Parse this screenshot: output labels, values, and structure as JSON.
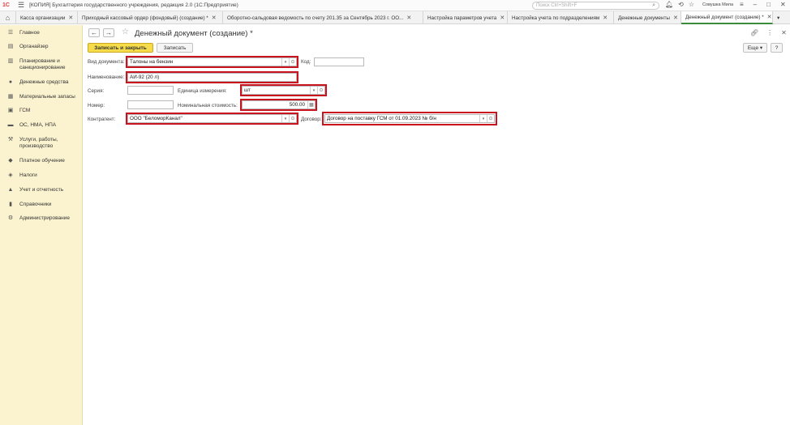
{
  "app": {
    "logo": "1С",
    "title": "[КОПИЯ] Бухгалтерия государственного учреждения, редакция 2.0  (1С:Предприятие)",
    "search_placeholder": "Поиск Ctrl+Shift+F",
    "user": "Совушка Мила"
  },
  "tabs": [
    {
      "label": "Касса организации"
    },
    {
      "label": "Приходный кассовый ордер (фондовый) (создание) *"
    },
    {
      "label": "Оборотно-сальдовая ведомость по счету 201.35 за Сентябрь 2023 г. ОО..."
    },
    {
      "label": "Настройка параметров учета"
    },
    {
      "label": "Настройка учета по подразделениям"
    },
    {
      "label": "Денежные документы"
    },
    {
      "label": "Денежный документ (создание) *"
    }
  ],
  "sidebar": {
    "items": [
      {
        "label": "Главное",
        "icon": "menu-icon"
      },
      {
        "label": "Органайзер",
        "icon": "organizer-icon"
      },
      {
        "label": "Планирование и санкционирование",
        "icon": "planning-icon"
      },
      {
        "label": "Денежные средства",
        "icon": "money-icon"
      },
      {
        "label": "Материальные запасы",
        "icon": "materials-icon"
      },
      {
        "label": "ГСМ",
        "icon": "fuel-icon"
      },
      {
        "label": "ОС, НМА, НПА",
        "icon": "assets-icon"
      },
      {
        "label": "Услуги, работы, производство",
        "icon": "services-icon"
      },
      {
        "label": "Платное обучение",
        "icon": "education-icon"
      },
      {
        "label": "Налоги",
        "icon": "taxes-icon"
      },
      {
        "label": "Учет и отчетность",
        "icon": "reports-icon"
      },
      {
        "label": "Справочники",
        "icon": "catalogs-icon"
      },
      {
        "label": "Администрирование",
        "icon": "admin-icon"
      }
    ]
  },
  "form": {
    "title": "Денежный документ (создание) *",
    "save_close_label": "Записать и закрыть",
    "save_label": "Записать",
    "more_label": "Еще",
    "help_label": "?",
    "doc_type_label": "Вид документа:",
    "doc_type_value": "Талоны на бензин",
    "code_label": "Код:",
    "code_value": "",
    "name_label": "Наименование:",
    "name_value": "АИ-92 (20 л)",
    "series_label": "Серия:",
    "series_value": "",
    "unit_label": "Единица измерения:",
    "unit_value": "шт",
    "number_label": "Номер:",
    "number_value": "",
    "nominal_label": "Номинальная стоимость:",
    "nominal_value": "500.00",
    "counterparty_label": "Контрагент:",
    "counterparty_value": "ООО \"БеломорКанал\"",
    "contract_label": "Договор:",
    "contract_value": "Договор на поставку ГСМ от 01.09.2023 № б/н"
  },
  "colors": {
    "sidebar_bg": "#fbf3cf",
    "primary_button": "#f6dc4a",
    "highlight": "#c8141e",
    "active_tab": "#3c8a3c"
  }
}
